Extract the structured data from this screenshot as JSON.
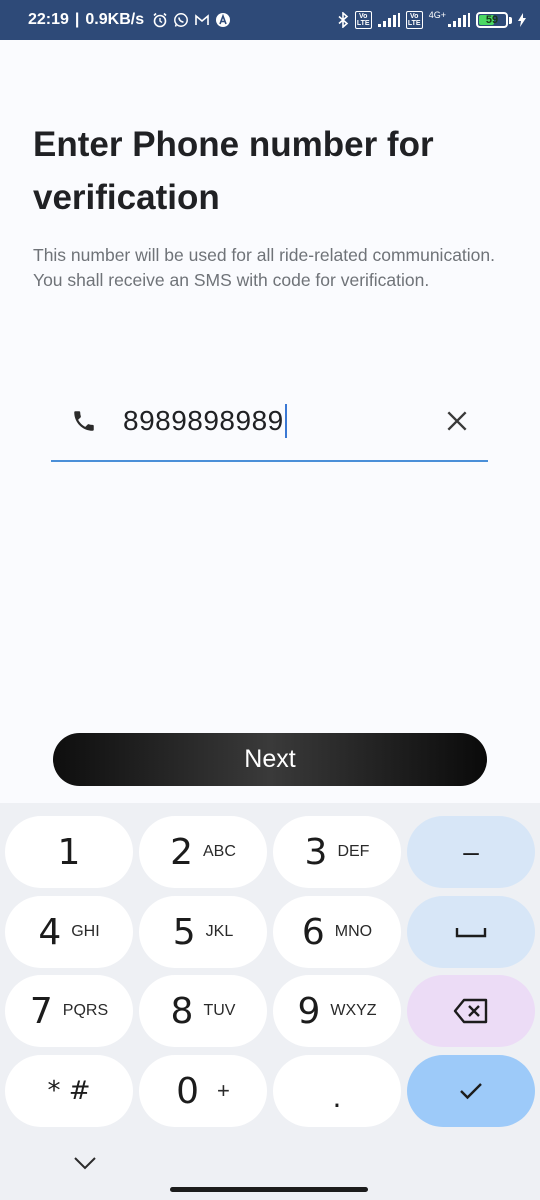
{
  "status_bar": {
    "time": "22:19",
    "separator": "|",
    "net_speed": "0.9KB/s",
    "icons": [
      "alarm-icon",
      "whatsapp-icon",
      "gmail-icon",
      "app-icon"
    ],
    "right_icons": [
      "bluetooth-icon",
      "volte-icon",
      "signal-icon",
      "volte-icon",
      "signal-4g-icon",
      "battery-icon",
      "charging-icon"
    ],
    "volte_label": "Vo LTE",
    "network_type": "4G+",
    "battery_level": "59"
  },
  "screen": {
    "title": "Enter Phone number for verification",
    "subtitle": "This number will be used for all ride-related communication. You shall receive an SMS with code for verification."
  },
  "phone_input": {
    "value": "8989898989",
    "icon": "phone-icon",
    "clear_icon": "close-icon"
  },
  "next_button": {
    "label": "Next"
  },
  "keyboard": {
    "keys": [
      {
        "digit": "1",
        "letters": ""
      },
      {
        "digit": "2",
        "letters": "ABC"
      },
      {
        "digit": "3",
        "letters": "DEF"
      },
      {
        "digit": "4",
        "letters": "GHI"
      },
      {
        "digit": "5",
        "letters": "JKL"
      },
      {
        "digit": "6",
        "letters": "MNO"
      },
      {
        "digit": "7",
        "letters": "PQRS"
      },
      {
        "digit": "8",
        "letters": "TUV"
      },
      {
        "digit": "9",
        "letters": "WXYZ"
      },
      {
        "digit": "* #",
        "letters": ""
      },
      {
        "digit": "0",
        "letters": "+"
      },
      {
        "digit": ".",
        "letters": ""
      }
    ],
    "minus_label": "–",
    "action_icons": [
      "minus-icon",
      "space-icon",
      "backspace-icon",
      "checkmark-icon"
    ]
  },
  "colors": {
    "accent": "#4a8fd8",
    "status_bar": "#2e4a78",
    "battery_fill": "#4cd964",
    "key_blue": "#d7e6f7",
    "key_purple": "#ecdcf6",
    "key_done": "#9dcaf9"
  }
}
